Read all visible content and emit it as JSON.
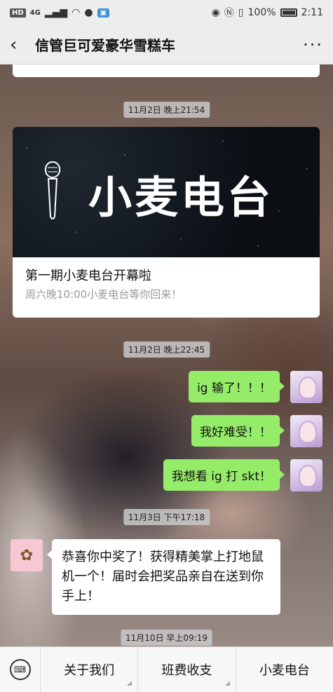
{
  "status_bar": {
    "left_badge": "HD",
    "network": "4G",
    "battery": "100%",
    "time": "2:11"
  },
  "header": {
    "title": "信管巨可爱豪华雪糕车"
  },
  "chat": {
    "time_1": "11月2日 晚上21:54",
    "article": {
      "banner_text": "小麦电台",
      "title": "第一期小麦电台开幕啦",
      "subtitle": "周六晚10:00小麦电台等你回来！"
    },
    "time_2": "11月2日 晚上22:45",
    "messages_out": [
      "ig 输了！！！",
      "我好难受！！",
      "我想看 ig 打 skt！"
    ],
    "time_3": "11月3日 下午17:18",
    "message_in": "恭喜你中奖了！获得精美掌上打地鼠机一个！届时会把奖品亲自在送到你手上！",
    "time_4": "11月10日 早上09:19"
  },
  "menu": {
    "items": [
      "关于我们",
      "班费收支",
      "小麦电台"
    ]
  }
}
